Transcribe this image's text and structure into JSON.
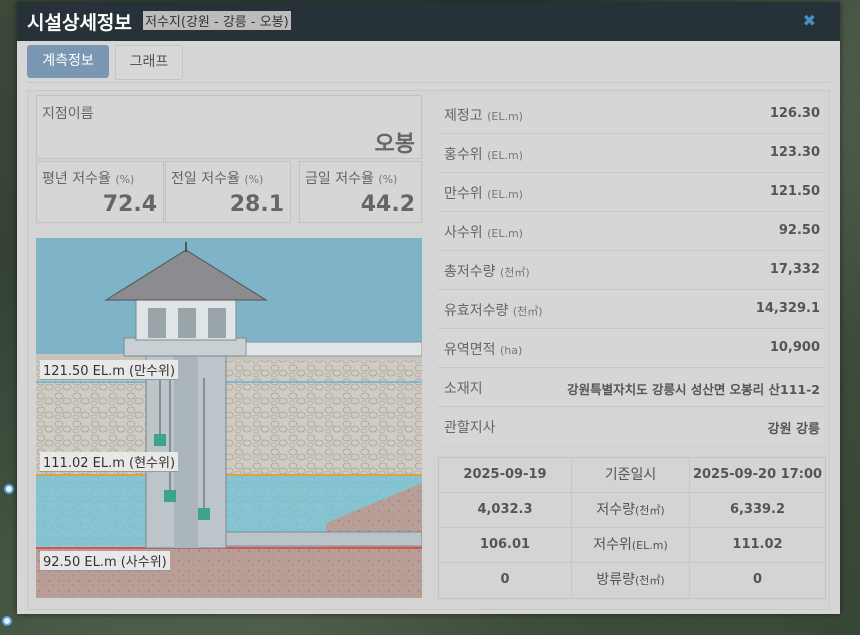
{
  "modal": {
    "title": "시설상세정보",
    "subtitle": "저수지(강원 - 강릉 - 오봉)",
    "close_icon": "close-icon"
  },
  "tabs": [
    {
      "label": "계측정보",
      "active": true
    },
    {
      "label": "그래프",
      "active": false
    }
  ],
  "station": {
    "label": "지점이름",
    "value": "오봉"
  },
  "rates": [
    {
      "label": "평년 저수율",
      "unit": "(%)",
      "value": "72.4"
    },
    {
      "label": "전일 저수율",
      "unit": "(%)",
      "value": "28.1"
    },
    {
      "label": "금일 저수율",
      "unit": "(%)",
      "value": "44.2"
    }
  ],
  "levels": {
    "full": "121.50 EL.m (만수위)",
    "current": "111.02 EL.m (현수위)",
    "dead": "92.50 EL.m (사수위)"
  },
  "info": [
    {
      "label": "제정고",
      "unit": "(EL.m)",
      "value": "126.30"
    },
    {
      "label": "홍수위",
      "unit": "(EL.m)",
      "value": "123.30"
    },
    {
      "label": "만수위",
      "unit": "(EL.m)",
      "value": "121.50"
    },
    {
      "label": "사수위",
      "unit": "(EL.m)",
      "value": "92.50"
    },
    {
      "label": "총저수량",
      "unit": "(천㎥)",
      "value": "17,332"
    },
    {
      "label": "유효저수량",
      "unit": "(천㎥)",
      "value": "14,329.1"
    },
    {
      "label": "유역면적",
      "unit": "(ha)",
      "value": "10,900"
    },
    {
      "label": "소재지",
      "unit": "",
      "value": "강원특별자치도 강릉시 성산면 오봉리 산111-2"
    },
    {
      "label": "관할지사",
      "unit": "",
      "value": "강원 강릉"
    }
  ],
  "compare": {
    "prev_date": "2025-09-19",
    "header_label": "기준일시",
    "curr_date": "2025-09-20 17:00",
    "rows": [
      {
        "prev": "4,032.3",
        "label": "저수량",
        "unit": "(천㎥)",
        "curr": "6,339.2"
      },
      {
        "prev": "106.01",
        "label": "저수위",
        "unit": "(EL.m)",
        "curr": "111.02"
      },
      {
        "prev": "0",
        "label": "방류량",
        "unit": "(천㎥)",
        "curr": "0"
      }
    ]
  },
  "colors": {
    "header": "#263238",
    "tab_active": "#7a98b4",
    "full_line": "#7ab8d8",
    "current_line": "#d9a441",
    "dead_line": "#d9534f"
  }
}
